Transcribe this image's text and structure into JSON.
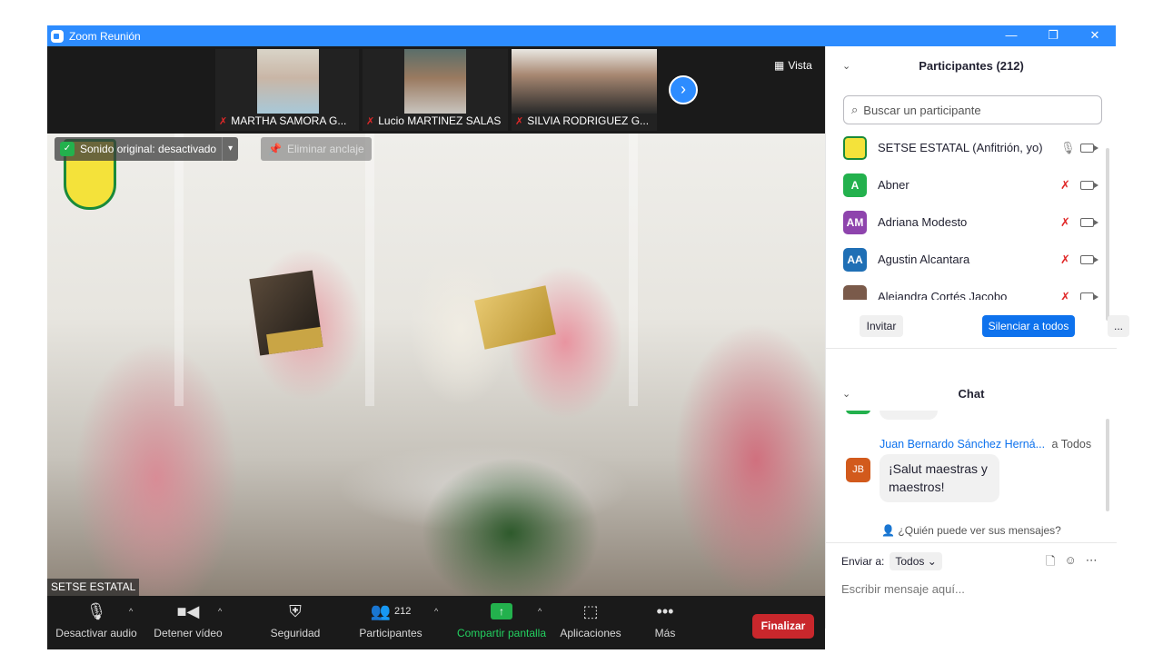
{
  "window": {
    "title": "Zoom Reunión",
    "minimize": "—",
    "restore": "❐",
    "close": "✕"
  },
  "strip": {
    "participants": [
      {
        "name": "MARTHA SAMORA G..."
      },
      {
        "name": "Lucio MARTINEZ SALAS"
      },
      {
        "name": "SILVIA RODRIGUEZ G..."
      }
    ],
    "next_label": "›",
    "view_label": "Vista"
  },
  "main": {
    "original_sound": "Sonido original: desactivado",
    "unpin": "Eliminar anclaje",
    "speaker": "SETSE ESTATAL"
  },
  "toolbar": {
    "audio": "Desactivar audio",
    "video": "Detener vídeo",
    "security": "Seguridad",
    "participants": "Participantes",
    "participants_count": "212",
    "share": "Compartir pantalla",
    "apps": "Aplicaciones",
    "more": "Más",
    "end": "Finalizar"
  },
  "panel": {
    "title": "Participantes (212)",
    "search_placeholder": "Buscar un participante",
    "participants": [
      {
        "name": "SETSE ESTATAL (Anfitrión, yo)",
        "initials": "",
        "color": "#f4e23a",
        "muted": false
      },
      {
        "name": "Abner",
        "initials": "A",
        "color": "#23b14d",
        "muted": true
      },
      {
        "name": "Adriana Modesto",
        "initials": "AM",
        "color": "#8e44ad",
        "muted": true
      },
      {
        "name": "Agustin Alcantara",
        "initials": "AA",
        "color": "#1f6fb5",
        "muted": true
      },
      {
        "name": "Alejandra Cortés Jacobo",
        "initials": "",
        "color": "#7a5a4a",
        "muted": true
      }
    ],
    "invite": "Invitar",
    "mute_all": "Silenciar a todos",
    "more": "..."
  },
  "chat": {
    "title": "Chat",
    "sender": "Juan Bernardo Sánchez Herná...",
    "to": "a Todos",
    "avatar": "JB",
    "message": "¡Salut maestras y maestros!",
    "who_can_see": "¿Quién puede ver sus mensajes?",
    "send_to_label": "Enviar a:",
    "send_to_value": "Todos",
    "input_placeholder": "Escribir mensaje aquí..."
  }
}
